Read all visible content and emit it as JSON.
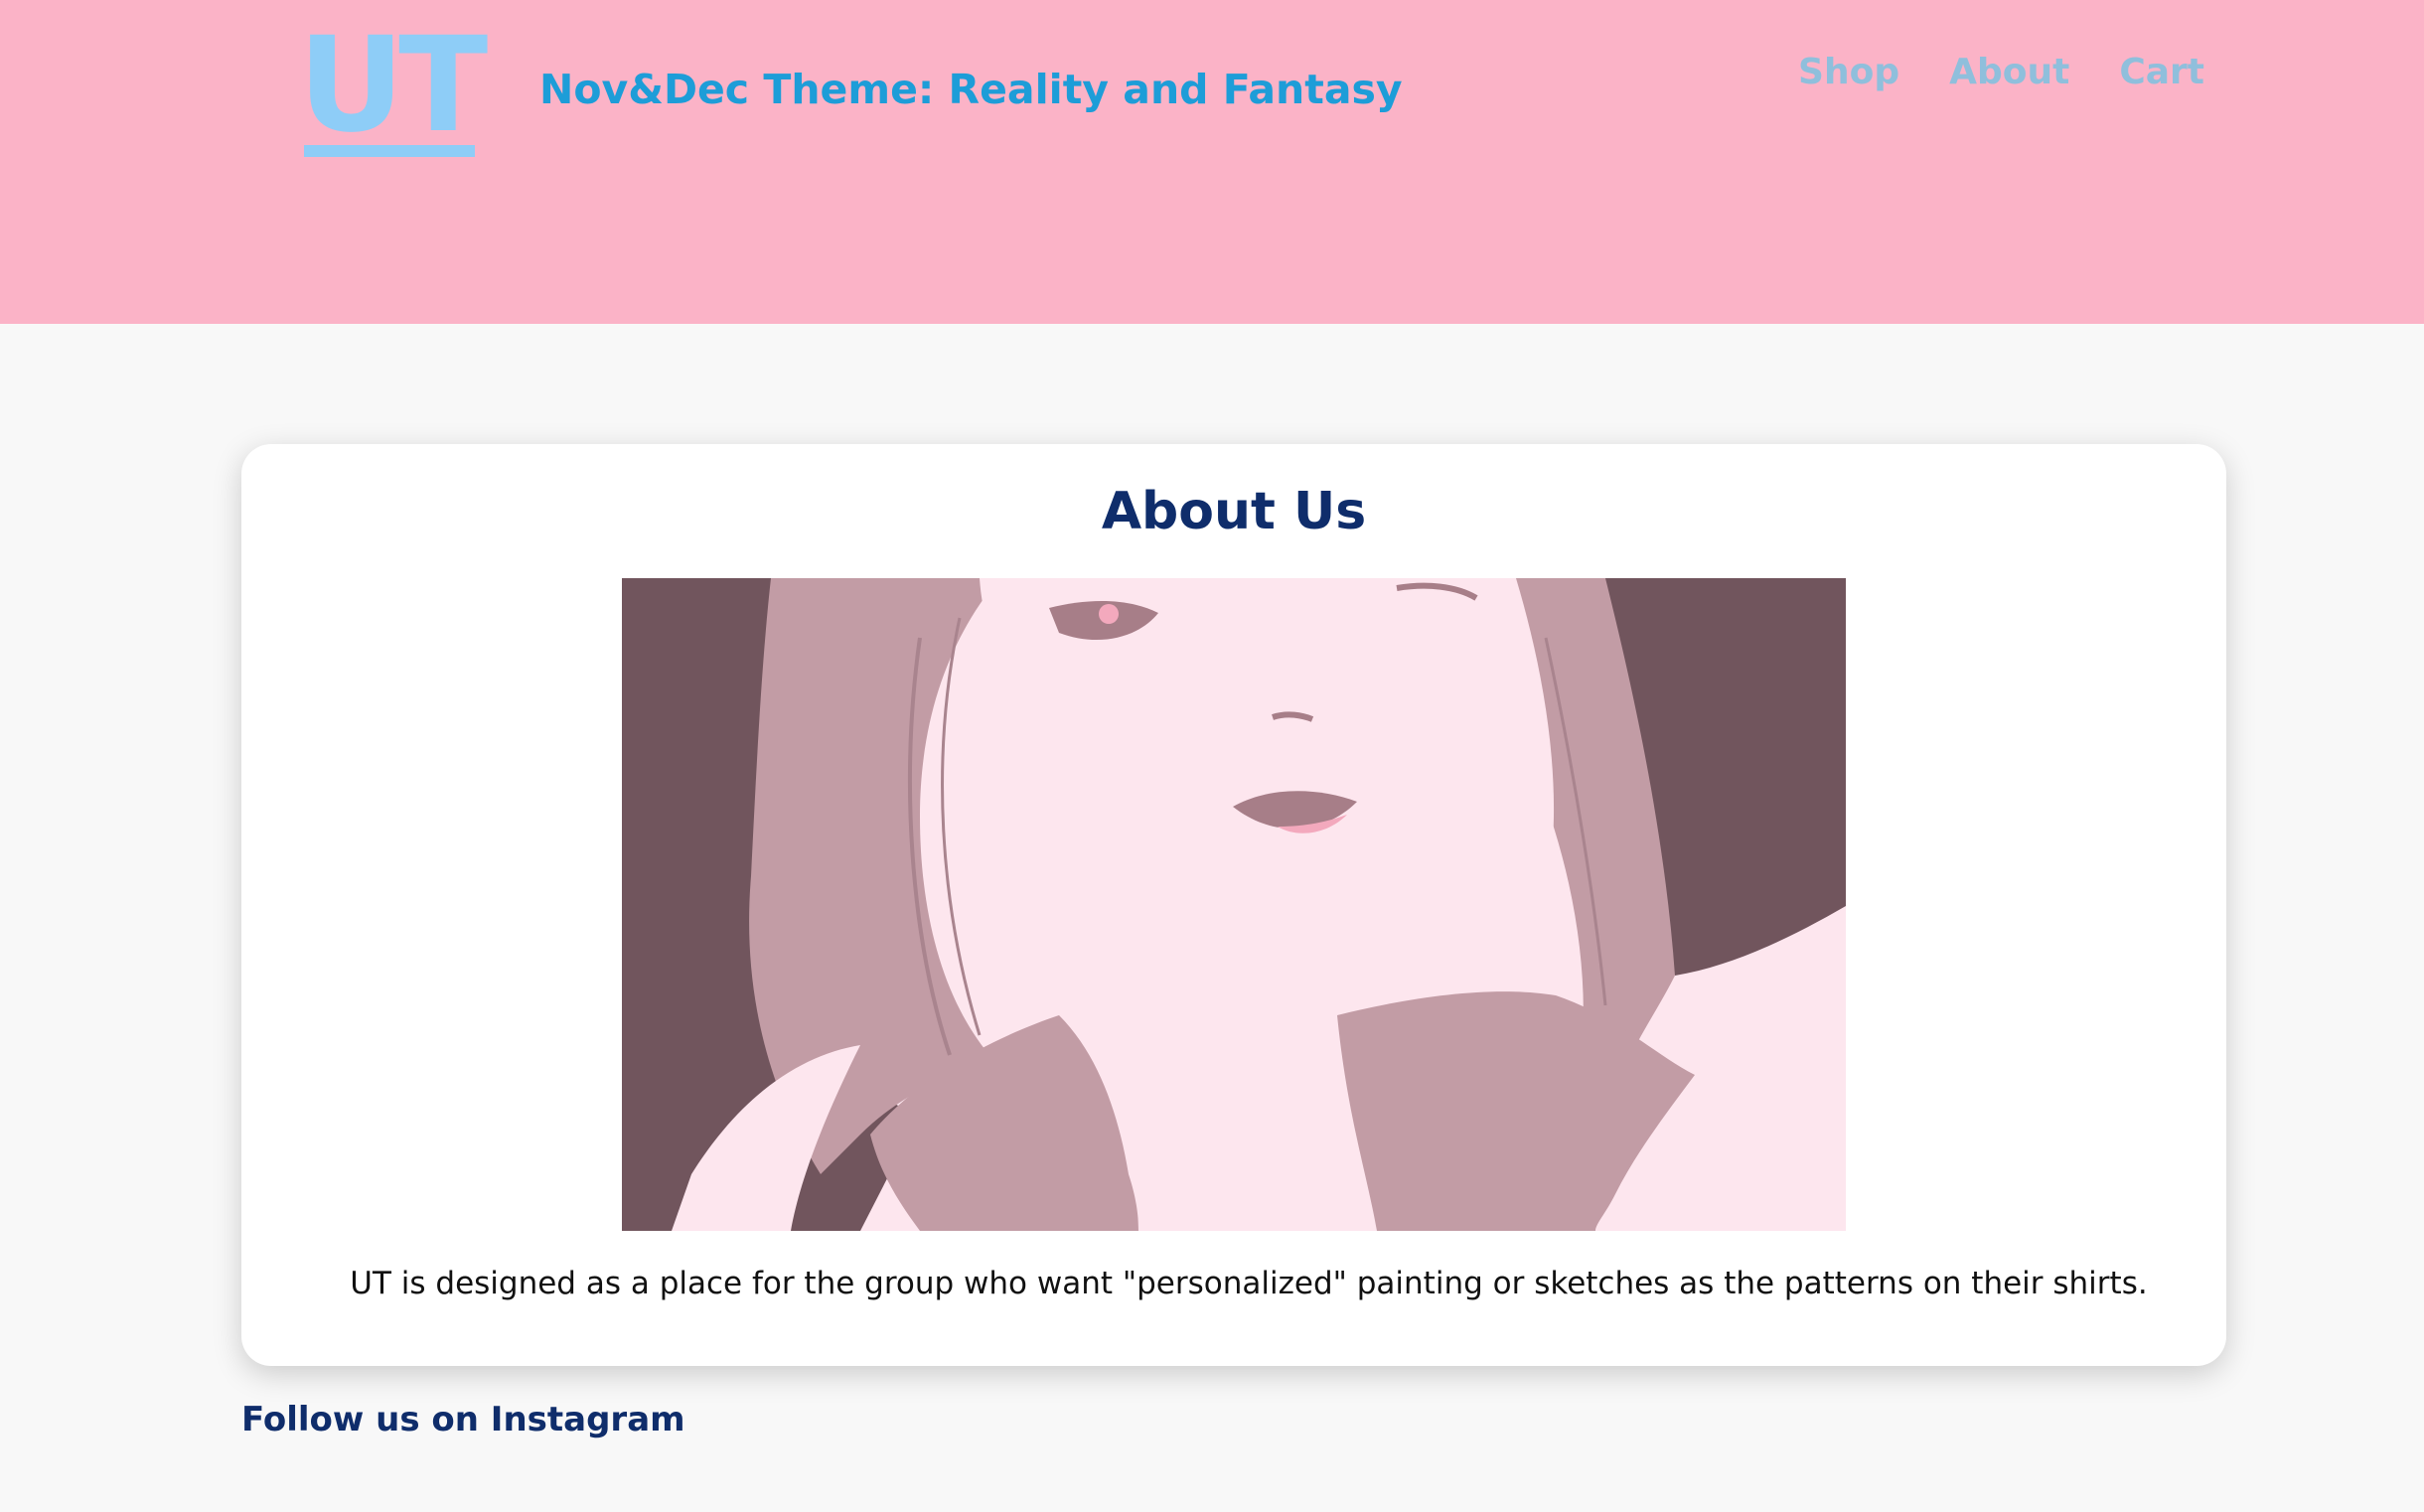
{
  "header": {
    "logo_text": "UT",
    "site_title": "Nov&Dec Theme: Reality and Fantasy",
    "nav": [
      {
        "label": "Shop"
      },
      {
        "label": "About"
      },
      {
        "label": "Cart"
      }
    ],
    "background_color": "#fbb3c7",
    "accent_color": "#1d9dd8"
  },
  "main": {
    "title": "About Us",
    "image_subject": "pink-toned illustration of a girl resting her chin on her hands",
    "description": "UT is designed as a place for the group who want \"personalized\" painting or sketches as the patterns on their shirts."
  },
  "footer": {
    "follow_label": "Follow us on Instagram"
  }
}
